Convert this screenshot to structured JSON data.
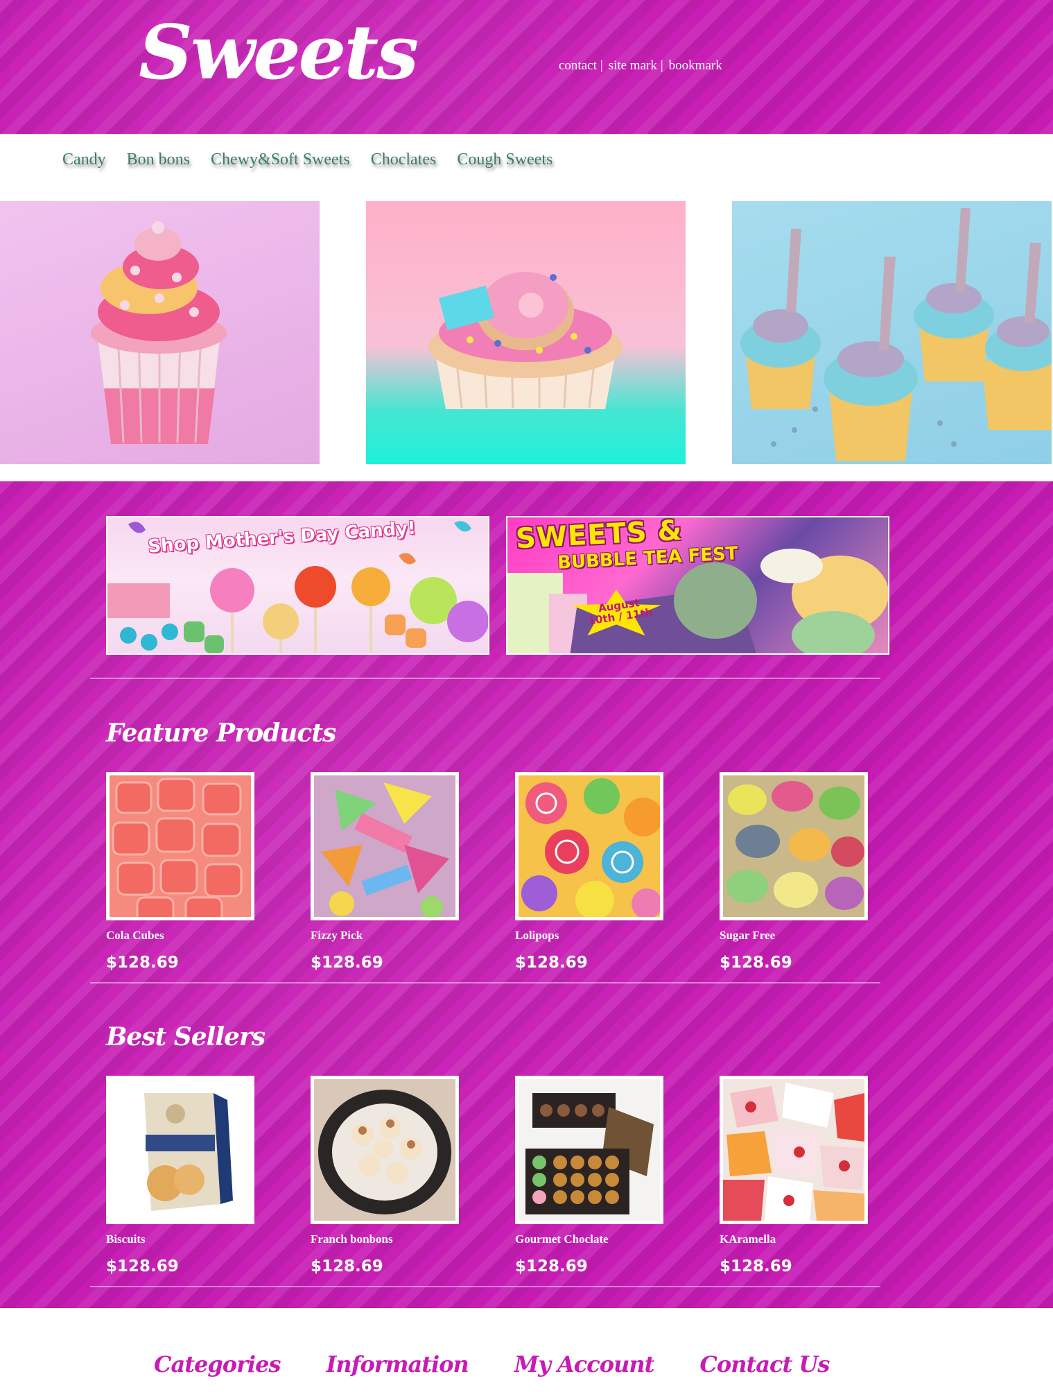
{
  "brand": {
    "logo": "Sweets",
    "primary_color": "#c71cb4",
    "nav_text_color": "#3a7d6a"
  },
  "top_links": [
    "contact",
    "site mark",
    "bookmark"
  ],
  "nav": {
    "items": [
      "Candy",
      "Bon bons",
      "Chewy&Soft Sweets",
      "Choclates",
      "Cough Sweets"
    ]
  },
  "hero": {
    "images": [
      "pink-swirl-cupcake",
      "donut-cupcake",
      "mermaid-cupcakes"
    ]
  },
  "banners": {
    "left": {
      "title": "Shop Mother's Day Candy!"
    },
    "right": {
      "title": "SWEETS &",
      "subtitle": "BUBBLE TEA FEST",
      "date_line1": "August",
      "date_line2": "10th / 11th"
    }
  },
  "featured": {
    "title": "Feature Products",
    "products": [
      {
        "name": "Cola Cubes",
        "price": "$128.69"
      },
      {
        "name": "Fizzy Pick",
        "price": "$128.69"
      },
      {
        "name": "Lolipops",
        "price": "$128.69"
      },
      {
        "name": "Sugar Free",
        "price": "$128.69"
      }
    ]
  },
  "best_sellers": {
    "title": "Best Sellers",
    "products": [
      {
        "name": "Biscuits",
        "price": "$128.69"
      },
      {
        "name": "Franch bonbons",
        "price": "$128.69"
      },
      {
        "name": "Gourmet Choclate",
        "price": "$128.69"
      },
      {
        "name": "KAramella",
        "price": "$128.69"
      }
    ]
  },
  "footer": {
    "items": [
      "Categories",
      "Information",
      "My Account",
      "Contact Us"
    ]
  }
}
